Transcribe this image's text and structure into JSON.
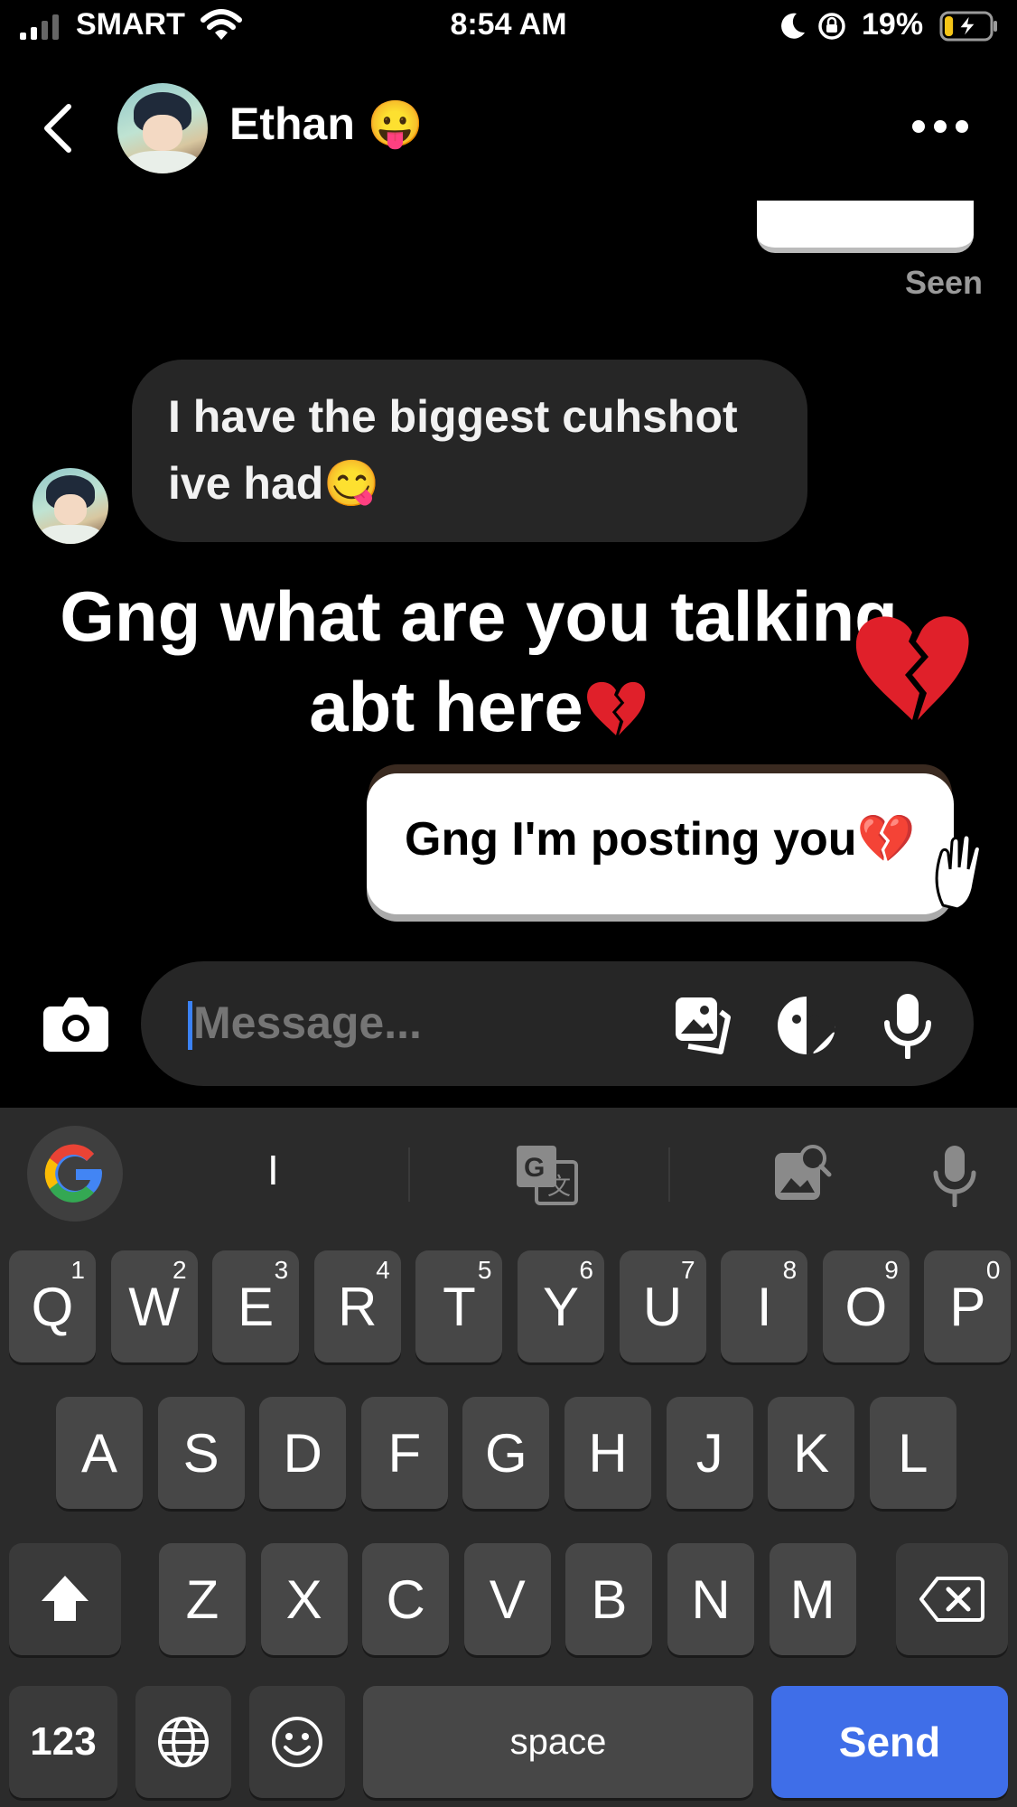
{
  "status_bar": {
    "carrier": "SMART",
    "time": "8:54 AM",
    "battery_percent": "19%",
    "battery_level": 0.19,
    "icons": [
      "signal-icon",
      "wifi-icon",
      "moon-icon",
      "rotation-lock-icon",
      "battery-charging-icon"
    ]
  },
  "header": {
    "contact_name": "Ethan 😛",
    "back_icon": "chevron-left-icon",
    "more_icon": "more-dots-icon"
  },
  "chat": {
    "seen_label": "Seen",
    "incoming_message": "I have the biggest cuhshot ive had😋",
    "overlay_caption_line1": "Gng what are you talking",
    "overlay_caption_line2": "abt here",
    "sticker_message": "Gng I'm posting you💔"
  },
  "composer": {
    "placeholder": "Message...",
    "icons": [
      "camera-icon",
      "gallery-icon",
      "sticker-icon",
      "microphone-icon"
    ]
  },
  "keyboard": {
    "suggestion": "I",
    "row1": [
      {
        "k": "Q",
        "n": "1"
      },
      {
        "k": "W",
        "n": "2"
      },
      {
        "k": "E",
        "n": "3"
      },
      {
        "k": "R",
        "n": "4"
      },
      {
        "k": "T",
        "n": "5"
      },
      {
        "k": "Y",
        "n": "6"
      },
      {
        "k": "U",
        "n": "7"
      },
      {
        "k": "I",
        "n": "8"
      },
      {
        "k": "O",
        "n": "9"
      },
      {
        "k": "P",
        "n": "0"
      }
    ],
    "row2": [
      "A",
      "S",
      "D",
      "F",
      "G",
      "H",
      "J",
      "K",
      "L"
    ],
    "row3": [
      "Z",
      "X",
      "C",
      "V",
      "B",
      "N",
      "M"
    ],
    "key_123": "123",
    "key_space": "space",
    "key_send": "Send",
    "accent_color": "#3f6ee8"
  }
}
